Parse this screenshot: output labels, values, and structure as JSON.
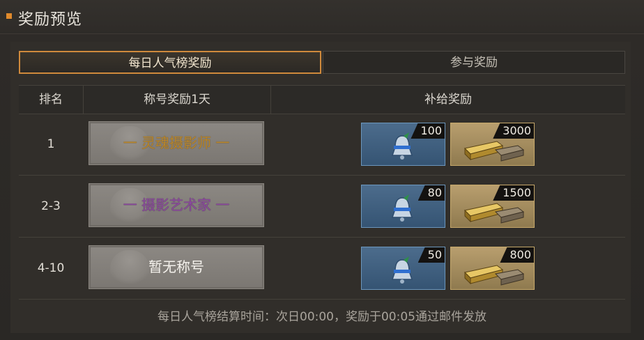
{
  "header": {
    "title": "奖励预览"
  },
  "tabs": [
    {
      "label": "每日人气榜奖励",
      "active": true
    },
    {
      "label": "参与奖励",
      "active": false
    }
  ],
  "table": {
    "headers": [
      "排名",
      "称号奖励1天",
      "补给奖励"
    ],
    "rows": [
      {
        "rank": "1",
        "title": "一 灵魂摄影师 一",
        "title_color": "#b8872e",
        "item1_icon": "bell-icon",
        "item1_qty": "100",
        "item2_icon": "gold-bars-icon",
        "item2_qty": "3000"
      },
      {
        "rank": "2-3",
        "title": "一 摄影艺术家 一",
        "title_color": "#8a4a9c",
        "item1_icon": "bell-icon",
        "item1_qty": "80",
        "item2_icon": "gold-bars-icon",
        "item2_qty": "1500"
      },
      {
        "rank": "4-10",
        "title": "暂无称号",
        "title_color": "#f4f1ec",
        "item1_icon": "bell-icon",
        "item1_qty": "50",
        "item2_icon": "gold-bars-icon",
        "item2_qty": "800"
      }
    ]
  },
  "footer": {
    "note": "每日人气榜结算时间：次日00:00，奖励于00:05通过邮件发放"
  },
  "colors": {
    "accent": "#e08a2c",
    "tab_border": "#d08a3c",
    "item_blue": "#4c6c8c",
    "item_gold": "#b89e6e"
  }
}
